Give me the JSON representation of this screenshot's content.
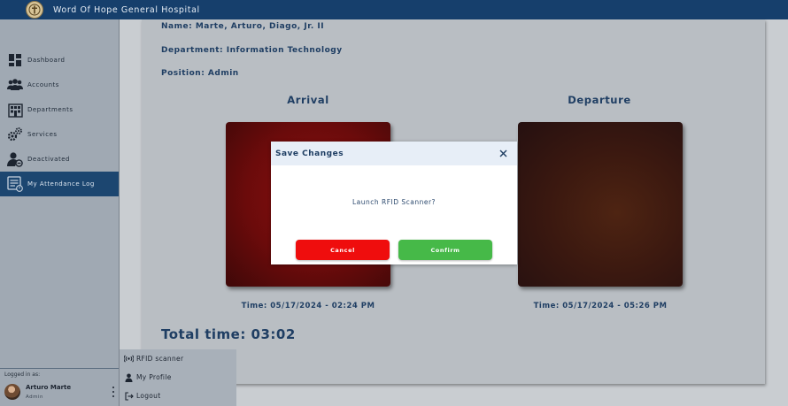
{
  "app": {
    "title": "Word Of Hope General Hospital",
    "logo_icon": "hospital-seal-icon"
  },
  "sidebar": {
    "items": [
      {
        "label": "Dashboard",
        "icon": "dashboard-icon"
      },
      {
        "label": "Accounts",
        "icon": "users-icon"
      },
      {
        "label": "Departments",
        "icon": "building-icon"
      },
      {
        "label": "Services",
        "icon": "gears-icon"
      },
      {
        "label": "Deactivated",
        "icon": "user-deactivated-icon"
      },
      {
        "label": "My Attendance Log",
        "icon": "attendance-log-icon",
        "active": true
      }
    ],
    "logged_in_caption": "Logged in as:",
    "user": {
      "name": "Arturo Marte",
      "role": "Admin"
    }
  },
  "popup_menu": {
    "items": [
      {
        "label": "RFID scanner",
        "icon": "rfid-icon"
      },
      {
        "label": "My Profile",
        "icon": "person-icon"
      },
      {
        "label": "Logout",
        "icon": "logout-icon"
      }
    ]
  },
  "main": {
    "name_line": "Name: Marte, Arturo, Diago, Jr. II",
    "department_line": "Department: Information Technology",
    "position_line": "Position: Admin",
    "arrival": {
      "heading": "Arrival",
      "time": "Time: 05/17/2024 - 02:24 PM"
    },
    "departure": {
      "heading": "Departure",
      "time": "Time: 05/17/2024 - 05:26 PM"
    },
    "total_time": "Total time: 03:02"
  },
  "modal": {
    "title": "Save Changes",
    "message": "Launch RFID Scanner?",
    "cancel_label": "Cancel",
    "confirm_label": "Confirm"
  },
  "colors": {
    "topbar": "#163f6c",
    "active_nav": "#1c4670",
    "text_primary": "#1f3e63",
    "cancel": "#ef0d0d",
    "confirm": "#46b948"
  }
}
